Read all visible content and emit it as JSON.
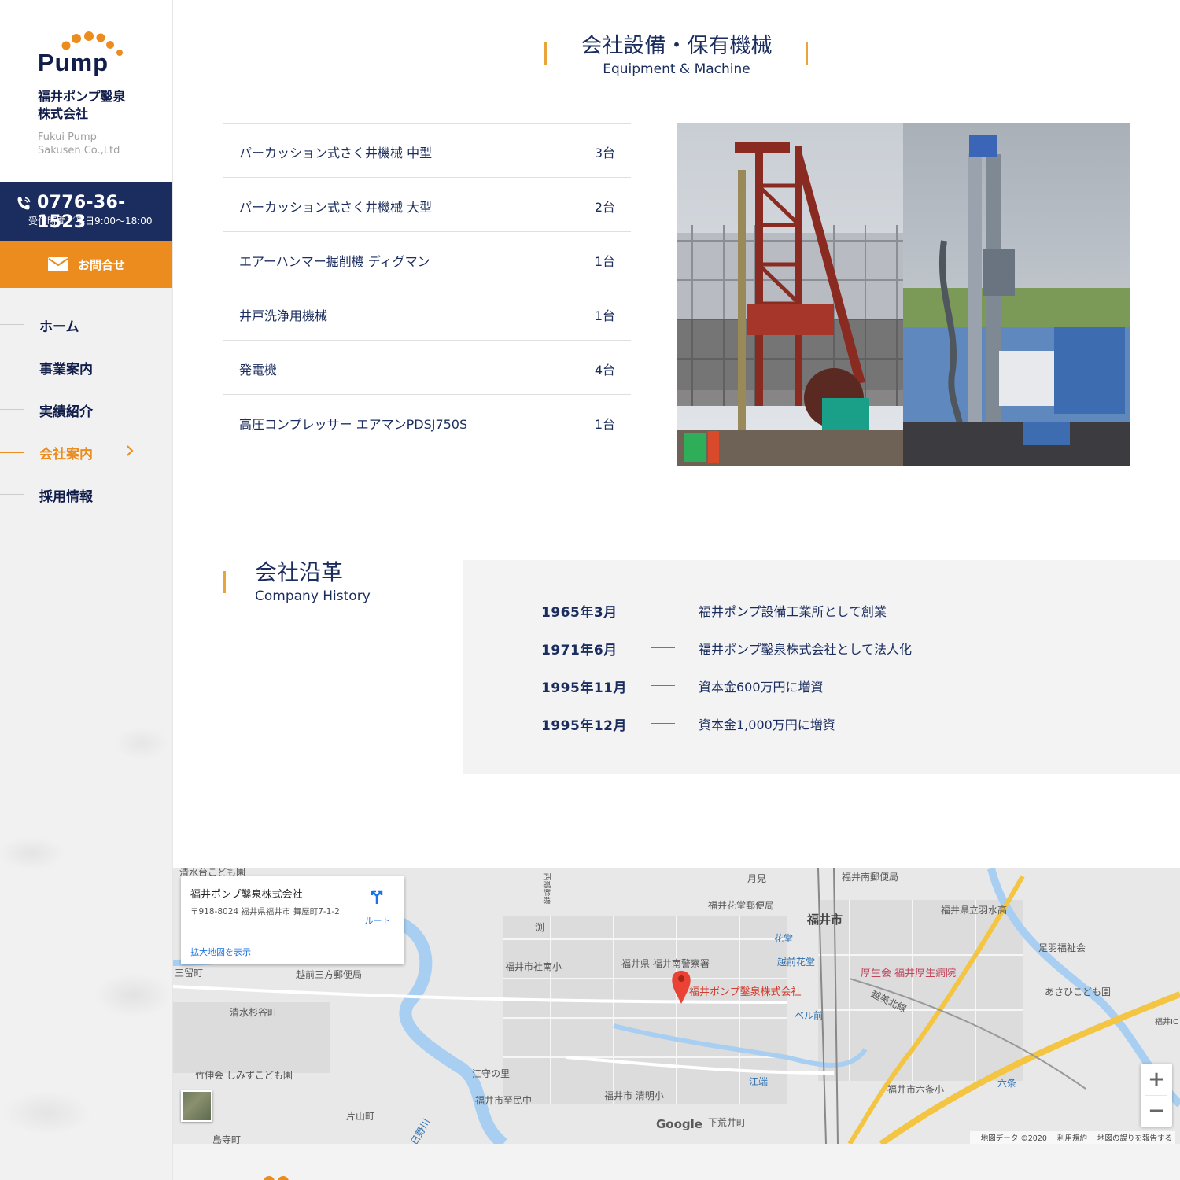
{
  "sidebar": {
    "logo_text": "Pump",
    "company_name_line1": "福井ポンプ鑿泉",
    "company_name_line2": "株式会社",
    "company_name_en_line1": "Fukui Pump",
    "company_name_en_line2": "Sakusen Co.,Ltd",
    "phone": "0776-36-1523",
    "hours": "受付時間／平日9:00〜18:00",
    "contact_label": "お問合せ",
    "nav": [
      {
        "label": "ホーム",
        "active": false
      },
      {
        "label": "事業案内",
        "active": false
      },
      {
        "label": "実績紹介",
        "active": false
      },
      {
        "label": "会社案内",
        "active": true
      },
      {
        "label": "採用情報",
        "active": false
      }
    ],
    "accent_color": "#ec8c1e",
    "navy_color": "#1a2d5e"
  },
  "equipment": {
    "title": "会社設備・保有機械",
    "subtitle": "Equipment & Machine",
    "items": [
      {
        "name": "パーカッション式さく井機械 中型",
        "count": "3台"
      },
      {
        "name": "パーカッション式さく井機械 大型",
        "count": "2台"
      },
      {
        "name": "エアーハンマー掘削機 ディグマン",
        "count": "1台"
      },
      {
        "name": "井戸洗浄用機械",
        "count": "1台"
      },
      {
        "name": "発電機",
        "count": "4台"
      },
      {
        "name": "高圧コンプレッサー エアマンPDSJ750S",
        "count": "1台"
      }
    ]
  },
  "history": {
    "title": "会社沿革",
    "subtitle": "Company History",
    "events": [
      {
        "date": "1965年3月",
        "text": "福井ポンプ設備工業所として創業"
      },
      {
        "date": "1971年6月",
        "text": "福井ポンプ鑿泉株式会社として法人化"
      },
      {
        "date": "1995年11月",
        "text": "資本金600万円に増資"
      },
      {
        "date": "1995年12月",
        "text": "資本金1,000万円に増資"
      }
    ]
  },
  "map": {
    "place_name": "福井ポンプ鑿泉株式会社",
    "address": "〒918-8024 福井県福井市 舞屋町7-1-2",
    "route_label": "ルート",
    "large_map_label": "拡大地図を表示",
    "marker_label": "福井ポンプ鑿泉株式会社",
    "zoom_in": "+",
    "zoom_out": "−",
    "google_label": "Google",
    "attribution": [
      "地図データ ©2020",
      "利用規約",
      "地図の誤りを報告する"
    ],
    "labels": [
      "清水台こども園",
      "月見",
      "福井南郵便局",
      "福井花堂郵便局",
      "福井市",
      "福井県立羽水高",
      "花堂",
      "足羽福祉会",
      "越前花堂",
      "福井市社南小",
      "福井県 福井南警察署",
      "厚生会 福井厚生病院",
      "三留町",
      "越前三方郵便局",
      "越美北線",
      "あさひこども園",
      "清水杉谷町",
      "ベル前",
      "福井IC",
      "竹伸会 しみずこども園",
      "江守の里",
      "江端",
      "六条",
      "福井市至民中",
      "福井市 清明小",
      "福井市六条小",
      "片山町",
      "下荒井町",
      "島寺町",
      "日野川",
      "西部幹線",
      "渕"
    ]
  }
}
